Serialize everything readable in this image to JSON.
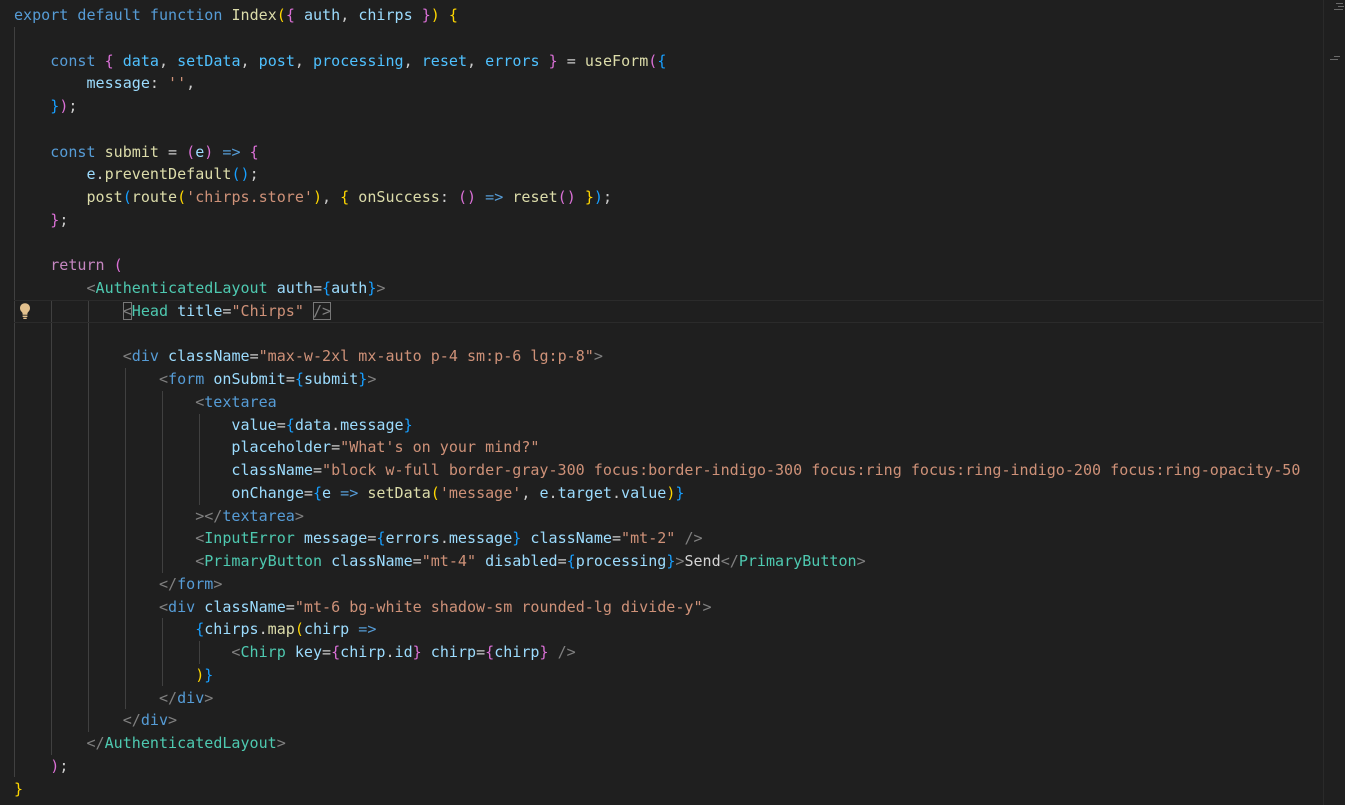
{
  "editor": {
    "language": "jsx",
    "lightbulb_icon": "lightbulb-icon",
    "colors": {
      "background": "#1f1f1f",
      "keyword": "#569cd6",
      "control": "#c586c0",
      "function": "#dcdcaa",
      "variable": "#9cdcfe",
      "string": "#ce9178",
      "component": "#4ec9b0",
      "bracket1": "#ffd700",
      "bracket2": "#da70d6",
      "bracket3": "#179fff"
    },
    "lines": [
      [
        [
          "kw",
          "export"
        ],
        [
          "pun",
          " "
        ],
        [
          "kw",
          "default"
        ],
        [
          "pun",
          " "
        ],
        [
          "kw",
          "function"
        ],
        [
          "pun",
          " "
        ],
        [
          "fn",
          "Index"
        ],
        [
          "b1",
          "("
        ],
        [
          "b2",
          "{"
        ],
        [
          "pun",
          " "
        ],
        [
          "var",
          "auth"
        ],
        [
          "pun",
          ", "
        ],
        [
          "var",
          "chirps"
        ],
        [
          "pun",
          " "
        ],
        [
          "b2",
          "}"
        ],
        [
          "b1",
          ")"
        ],
        [
          "pun",
          " "
        ],
        [
          "b1",
          "{"
        ]
      ],
      [],
      [
        [
          "pun",
          "    "
        ],
        [
          "kw",
          "const"
        ],
        [
          "pun",
          " "
        ],
        [
          "b2",
          "{"
        ],
        [
          "pun",
          " "
        ],
        [
          "cst",
          "data"
        ],
        [
          "pun",
          ", "
        ],
        [
          "cst",
          "setData"
        ],
        [
          "pun",
          ", "
        ],
        [
          "cst",
          "post"
        ],
        [
          "pun",
          ", "
        ],
        [
          "cst",
          "processing"
        ],
        [
          "pun",
          ", "
        ],
        [
          "cst",
          "reset"
        ],
        [
          "pun",
          ", "
        ],
        [
          "cst",
          "errors"
        ],
        [
          "pun",
          " "
        ],
        [
          "b2",
          "}"
        ],
        [
          "pun",
          " = "
        ],
        [
          "fn",
          "useForm"
        ],
        [
          "b2",
          "("
        ],
        [
          "b3",
          "{"
        ]
      ],
      [
        [
          "pun",
          "        "
        ],
        [
          "var",
          "message"
        ],
        [
          "pun",
          ": "
        ],
        [
          "str",
          "''"
        ],
        [
          "pun",
          ","
        ]
      ],
      [
        [
          "pun",
          "    "
        ],
        [
          "b3",
          "}"
        ],
        [
          "b2",
          ")"
        ],
        [
          "pun",
          ";"
        ]
      ],
      [],
      [
        [
          "pun",
          "    "
        ],
        [
          "kw",
          "const"
        ],
        [
          "pun",
          " "
        ],
        [
          "fn",
          "submit"
        ],
        [
          "pun",
          " = "
        ],
        [
          "b2",
          "("
        ],
        [
          "var",
          "e"
        ],
        [
          "b2",
          ")"
        ],
        [
          "pun",
          " "
        ],
        [
          "kw",
          "=>"
        ],
        [
          "pun",
          " "
        ],
        [
          "b2",
          "{"
        ]
      ],
      [
        [
          "pun",
          "        "
        ],
        [
          "var",
          "e"
        ],
        [
          "pun",
          "."
        ],
        [
          "fn",
          "preventDefault"
        ],
        [
          "b3",
          "("
        ],
        [
          "b3",
          ")"
        ],
        [
          "pun",
          ";"
        ]
      ],
      [
        [
          "pun",
          "        "
        ],
        [
          "fn",
          "post"
        ],
        [
          "b3",
          "("
        ],
        [
          "fn",
          "route"
        ],
        [
          "b1",
          "("
        ],
        [
          "str",
          "'chirps.store'"
        ],
        [
          "b1",
          ")"
        ],
        [
          "pun",
          ", "
        ],
        [
          "b1",
          "{"
        ],
        [
          "pun",
          " "
        ],
        [
          "fn",
          "onSuccess"
        ],
        [
          "pun",
          ": "
        ],
        [
          "b2",
          "("
        ],
        [
          "b2",
          ")"
        ],
        [
          "pun",
          " "
        ],
        [
          "kw",
          "=>"
        ],
        [
          "pun",
          " "
        ],
        [
          "fn",
          "reset"
        ],
        [
          "b2",
          "("
        ],
        [
          "b2",
          ")"
        ],
        [
          "pun",
          " "
        ],
        [
          "b1",
          "}"
        ],
        [
          "b3",
          ")"
        ],
        [
          "pun",
          ";"
        ]
      ],
      [
        [
          "pun",
          "    "
        ],
        [
          "b2",
          "}"
        ],
        [
          "pun",
          ";"
        ]
      ],
      [],
      [
        [
          "pun",
          "    "
        ],
        [
          "ctl",
          "return"
        ],
        [
          "pun",
          " "
        ],
        [
          "b2",
          "("
        ]
      ],
      [
        [
          "pun",
          "        "
        ],
        [
          "ang",
          "<"
        ],
        [
          "cmp",
          "AuthenticatedLayout"
        ],
        [
          "pun",
          " "
        ],
        [
          "attr",
          "auth"
        ],
        [
          "pun",
          "="
        ],
        [
          "b3",
          "{"
        ],
        [
          "var",
          "auth"
        ],
        [
          "b3",
          "}"
        ],
        [
          "ang",
          ">"
        ]
      ],
      [
        [
          "pun",
          "            "
        ],
        [
          "ang",
          "<"
        ],
        [
          "cmp",
          "Head"
        ],
        [
          "pun",
          " "
        ],
        [
          "attr",
          "title"
        ],
        [
          "pun",
          "="
        ],
        [
          "str",
          "\"Chirps\""
        ],
        [
          "pun",
          " "
        ],
        [
          "ang",
          "/>"
        ]
      ],
      [],
      [
        [
          "pun",
          "            "
        ],
        [
          "ang",
          "<"
        ],
        [
          "tag",
          "div"
        ],
        [
          "pun",
          " "
        ],
        [
          "attr",
          "className"
        ],
        [
          "pun",
          "="
        ],
        [
          "str",
          "\"max-w-2xl mx-auto p-4 sm:p-6 lg:p-8\""
        ],
        [
          "ang",
          ">"
        ]
      ],
      [
        [
          "pun",
          "                "
        ],
        [
          "ang",
          "<"
        ],
        [
          "tag",
          "form"
        ],
        [
          "pun",
          " "
        ],
        [
          "attr",
          "onSubmit"
        ],
        [
          "pun",
          "="
        ],
        [
          "b3",
          "{"
        ],
        [
          "var",
          "submit"
        ],
        [
          "b3",
          "}"
        ],
        [
          "ang",
          ">"
        ]
      ],
      [
        [
          "pun",
          "                    "
        ],
        [
          "ang",
          "<"
        ],
        [
          "tag",
          "textarea"
        ]
      ],
      [
        [
          "pun",
          "                        "
        ],
        [
          "attr",
          "value"
        ],
        [
          "pun",
          "="
        ],
        [
          "b3",
          "{"
        ],
        [
          "var",
          "data"
        ],
        [
          "pun",
          "."
        ],
        [
          "var",
          "message"
        ],
        [
          "b3",
          "}"
        ]
      ],
      [
        [
          "pun",
          "                        "
        ],
        [
          "attr",
          "placeholder"
        ],
        [
          "pun",
          "="
        ],
        [
          "str",
          "\"What's on your mind?\""
        ]
      ],
      [
        [
          "pun",
          "                        "
        ],
        [
          "attr",
          "className"
        ],
        [
          "pun",
          "="
        ],
        [
          "str",
          "\"block w-full border-gray-300 focus:border-indigo-300 focus:ring focus:ring-indigo-200 focus:ring-opacity-50"
        ]
      ],
      [
        [
          "pun",
          "                        "
        ],
        [
          "attr",
          "onChange"
        ],
        [
          "pun",
          "="
        ],
        [
          "b3",
          "{"
        ],
        [
          "var",
          "e"
        ],
        [
          "pun",
          " "
        ],
        [
          "kw",
          "=>"
        ],
        [
          "pun",
          " "
        ],
        [
          "fn",
          "setData"
        ],
        [
          "b1",
          "("
        ],
        [
          "str",
          "'message'"
        ],
        [
          "pun",
          ", "
        ],
        [
          "var",
          "e"
        ],
        [
          "pun",
          "."
        ],
        [
          "var",
          "target"
        ],
        [
          "pun",
          "."
        ],
        [
          "var",
          "value"
        ],
        [
          "b1",
          ")"
        ],
        [
          "b3",
          "}"
        ]
      ],
      [
        [
          "pun",
          "                    "
        ],
        [
          "ang",
          "></"
        ],
        [
          "tag",
          "textarea"
        ],
        [
          "ang",
          ">"
        ]
      ],
      [
        [
          "pun",
          "                    "
        ],
        [
          "ang",
          "<"
        ],
        [
          "cmp",
          "InputError"
        ],
        [
          "pun",
          " "
        ],
        [
          "attr",
          "message"
        ],
        [
          "pun",
          "="
        ],
        [
          "b3",
          "{"
        ],
        [
          "var",
          "errors"
        ],
        [
          "pun",
          "."
        ],
        [
          "var",
          "message"
        ],
        [
          "b3",
          "}"
        ],
        [
          "pun",
          " "
        ],
        [
          "attr",
          "className"
        ],
        [
          "pun",
          "="
        ],
        [
          "str",
          "\"mt-2\""
        ],
        [
          "pun",
          " "
        ],
        [
          "ang",
          "/>"
        ]
      ],
      [
        [
          "pun",
          "                    "
        ],
        [
          "ang",
          "<"
        ],
        [
          "cmp",
          "PrimaryButton"
        ],
        [
          "pun",
          " "
        ],
        [
          "attr",
          "className"
        ],
        [
          "pun",
          "="
        ],
        [
          "str",
          "\"mt-4\""
        ],
        [
          "pun",
          " "
        ],
        [
          "attr",
          "disabled"
        ],
        [
          "pun",
          "="
        ],
        [
          "b3",
          "{"
        ],
        [
          "var",
          "processing"
        ],
        [
          "b3",
          "}"
        ],
        [
          "ang",
          ">"
        ],
        [
          "txt",
          "Send"
        ],
        [
          "ang",
          "</"
        ],
        [
          "cmp",
          "PrimaryButton"
        ],
        [
          "ang",
          ">"
        ]
      ],
      [
        [
          "pun",
          "                "
        ],
        [
          "ang",
          "</"
        ],
        [
          "tag",
          "form"
        ],
        [
          "ang",
          ">"
        ]
      ],
      [
        [
          "pun",
          "                "
        ],
        [
          "ang",
          "<"
        ],
        [
          "tag",
          "div"
        ],
        [
          "pun",
          " "
        ],
        [
          "attr",
          "className"
        ],
        [
          "pun",
          "="
        ],
        [
          "str",
          "\"mt-6 bg-white shadow-sm rounded-lg divide-y\""
        ],
        [
          "ang",
          ">"
        ]
      ],
      [
        [
          "pun",
          "                    "
        ],
        [
          "b3",
          "{"
        ],
        [
          "var",
          "chirps"
        ],
        [
          "pun",
          "."
        ],
        [
          "fn",
          "map"
        ],
        [
          "b1",
          "("
        ],
        [
          "var",
          "chirp"
        ],
        [
          "pun",
          " "
        ],
        [
          "kw",
          "=>"
        ]
      ],
      [
        [
          "pun",
          "                        "
        ],
        [
          "ang",
          "<"
        ],
        [
          "cmp",
          "Chirp"
        ],
        [
          "pun",
          " "
        ],
        [
          "attr",
          "key"
        ],
        [
          "pun",
          "="
        ],
        [
          "b2",
          "{"
        ],
        [
          "var",
          "chirp"
        ],
        [
          "pun",
          "."
        ],
        [
          "var",
          "id"
        ],
        [
          "b2",
          "}"
        ],
        [
          "pun",
          " "
        ],
        [
          "attr",
          "chirp"
        ],
        [
          "pun",
          "="
        ],
        [
          "b2",
          "{"
        ],
        [
          "var",
          "chirp"
        ],
        [
          "b2",
          "}"
        ],
        [
          "pun",
          " "
        ],
        [
          "ang",
          "/>"
        ]
      ],
      [
        [
          "pun",
          "                    "
        ],
        [
          "b1",
          ")"
        ],
        [
          "b3",
          "}"
        ]
      ],
      [
        [
          "pun",
          "                "
        ],
        [
          "ang",
          "</"
        ],
        [
          "tag",
          "div"
        ],
        [
          "ang",
          ">"
        ]
      ],
      [
        [
          "pun",
          "            "
        ],
        [
          "ang",
          "</"
        ],
        [
          "tag",
          "div"
        ],
        [
          "ang",
          ">"
        ]
      ],
      [
        [
          "pun",
          "        "
        ],
        [
          "ang",
          "</"
        ],
        [
          "cmp",
          "AuthenticatedLayout"
        ],
        [
          "ang",
          ">"
        ]
      ],
      [
        [
          "pun",
          "    "
        ],
        [
          "b2",
          ")"
        ],
        [
          "pun",
          ";"
        ]
      ],
      [
        [
          "b1",
          "}"
        ]
      ]
    ]
  }
}
